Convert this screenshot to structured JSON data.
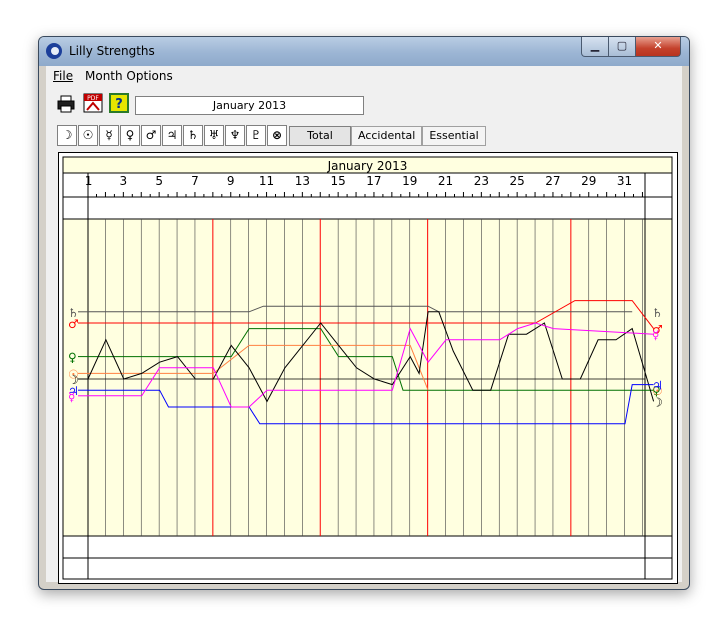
{
  "window": {
    "title": "Lilly Strengths"
  },
  "menu": {
    "file": "File",
    "month_options": "Month Options"
  },
  "toolbar": {
    "date_value": "January 2013"
  },
  "planet_buttons": [
    "☽",
    "☉",
    "☿",
    "♀",
    "♂",
    "♃",
    "♄",
    "♅",
    "♆",
    "♇",
    "⊗"
  ],
  "mode_tabs": {
    "total": "Total",
    "accidental": "Accidental",
    "essential": "Essential",
    "selected": "Total"
  },
  "chart_data": {
    "type": "line",
    "title": "January 2013",
    "x_tick_labels": [
      "1",
      "3",
      "5",
      "7",
      "9",
      "11",
      "13",
      "15",
      "17",
      "19",
      "21",
      "23",
      "25",
      "27",
      "29",
      "31"
    ],
    "xlim": [
      0,
      31
    ],
    "red_vertical_days": [
      7,
      13,
      19,
      27
    ],
    "series": [
      {
        "symbol": "♄",
        "color": "#555555",
        "points": [
          [
            0,
            12
          ],
          [
            9,
            12
          ],
          [
            9.8,
            13
          ],
          [
            19,
            13
          ],
          [
            19.6,
            12
          ],
          [
            27,
            12
          ],
          [
            29.2,
            12
          ],
          [
            30.4,
            12
          ]
        ]
      },
      {
        "symbol": "♂",
        "color": "#ff0000",
        "points": [
          [
            0,
            10
          ],
          [
            25,
            10
          ],
          [
            27.2,
            14
          ],
          [
            30.4,
            14
          ],
          [
            31.6,
            9
          ]
        ]
      },
      {
        "symbol": "♀",
        "color": "#007000",
        "points": [
          [
            0,
            4
          ],
          [
            8,
            4
          ],
          [
            9,
            9
          ],
          [
            13,
            9
          ],
          [
            14,
            4
          ],
          [
            17,
            4
          ],
          [
            17.6,
            -2
          ],
          [
            31.6,
            -2
          ]
        ]
      },
      {
        "symbol": "☉",
        "color": "#ff8040",
        "points": [
          [
            0,
            1
          ],
          [
            7,
            1
          ],
          [
            9,
            6
          ],
          [
            18,
            6
          ],
          [
            19,
            -2
          ]
        ]
      },
      {
        "symbol": "☽",
        "color": "#000000",
        "points": [
          [
            0,
            0
          ],
          [
            1,
            7
          ],
          [
            2,
            0
          ],
          [
            3,
            1
          ],
          [
            4,
            3
          ],
          [
            5,
            4
          ],
          [
            6,
            0
          ],
          [
            7,
            0
          ],
          [
            8,
            6
          ],
          [
            9,
            2
          ],
          [
            10,
            -4
          ],
          [
            11,
            2
          ],
          [
            13,
            10
          ],
          [
            14,
            6
          ],
          [
            15,
            2
          ],
          [
            16,
            0
          ],
          [
            17,
            -1
          ],
          [
            18,
            4
          ],
          [
            18.5,
            1
          ],
          [
            19,
            12
          ],
          [
            19.6,
            12
          ],
          [
            20.4,
            5
          ],
          [
            21.5,
            -2
          ],
          [
            22.5,
            -2
          ],
          [
            23.5,
            8
          ],
          [
            24.5,
            8
          ],
          [
            25.5,
            10
          ],
          [
            26.5,
            0
          ],
          [
            27.5,
            0
          ],
          [
            28.5,
            7
          ],
          [
            29.5,
            7
          ],
          [
            30.4,
            9
          ],
          [
            31.6,
            -4
          ]
        ]
      },
      {
        "symbol": "♃",
        "color": "#0000ff",
        "points": [
          [
            0,
            -2
          ],
          [
            4,
            -2
          ],
          [
            4.5,
            -5
          ],
          [
            9,
            -5
          ],
          [
            9.6,
            -8
          ],
          [
            30,
            -8
          ],
          [
            30.4,
            -1
          ],
          [
            31.6,
            -1
          ]
        ]
      },
      {
        "symbol": "☿",
        "color": "#ff00ff",
        "points": [
          [
            0,
            -3
          ],
          [
            3,
            -3
          ],
          [
            4,
            2
          ],
          [
            7,
            2
          ],
          [
            8,
            -5
          ],
          [
            9,
            -5
          ],
          [
            10,
            -2
          ],
          [
            17,
            -2
          ],
          [
            18,
            9
          ],
          [
            19,
            3
          ],
          [
            20,
            7
          ],
          [
            23,
            7
          ],
          [
            24,
            9
          ],
          [
            25,
            10
          ],
          [
            26,
            9
          ],
          [
            31.6,
            8
          ]
        ]
      }
    ]
  }
}
